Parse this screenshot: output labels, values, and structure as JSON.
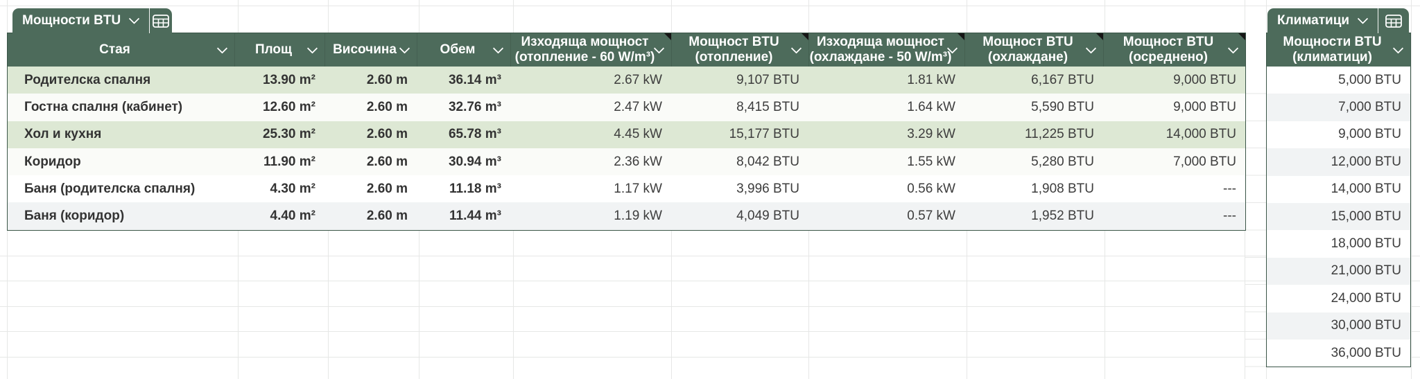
{
  "colors": {
    "accent_green": "#4d6b5b",
    "border_green": "#3a5547",
    "row_green": "#dde8d4",
    "row_gray": "#f1f3f4",
    "header_text": "#ffffff"
  },
  "icons": {
    "tab_icon": "table-grid-icon",
    "header_dropdown": "chevron-down-icon",
    "comment_marker": "comment-triangle"
  },
  "main_table": {
    "tab": {
      "title": "Мощности BTU"
    },
    "columns": [
      {
        "line1": "Стая"
      },
      {
        "line1": "Площ"
      },
      {
        "line1": "Височина"
      },
      {
        "line1": "Обем"
      },
      {
        "line1": "Изходяща мощност",
        "line2": "(отопление - 60 W/m³)"
      },
      {
        "line1": "Мощност BTU",
        "line2": "(отопление)"
      },
      {
        "line1": "Изходяща мощност",
        "line2": "(охлаждане - 50 W/m³)"
      },
      {
        "line1": "Мощност BTU",
        "line2": "(охлаждане)"
      },
      {
        "line1": "Мощност BTU",
        "line2": "(осреднено)"
      }
    ],
    "rows": [
      {
        "room": "Родителска спалня",
        "area": "13.90 m²",
        "height": "2.60 m",
        "volume": "36.14 m³",
        "heat_kw": "2.67 kW",
        "heat_btu": "9,107 BTU",
        "cool_kw": "1.81 kW",
        "cool_btu": "6,167 BTU",
        "avg_btu": "9,000 BTU"
      },
      {
        "room": "Гостна спалня (кабинет)",
        "area": "12.60 m²",
        "height": "2.60 m",
        "volume": "32.76 m³",
        "heat_kw": "2.47 kW",
        "heat_btu": "8,415 BTU",
        "cool_kw": "1.64 kW",
        "cool_btu": "5,590 BTU",
        "avg_btu": "9,000 BTU"
      },
      {
        "room": "Хол и кухня",
        "area": "25.30 m²",
        "height": "2.60 m",
        "volume": "65.78 m³",
        "heat_kw": "4.45 kW",
        "heat_btu": "15,177 BTU",
        "cool_kw": "3.29 kW",
        "cool_btu": "11,225 BTU",
        "avg_btu": "14,000 BTU"
      },
      {
        "room": "Коридор",
        "area": "11.90 m²",
        "height": "2.60 m",
        "volume": "30.94 m³",
        "heat_kw": "2.36 kW",
        "heat_btu": "8,042 BTU",
        "cool_kw": "1.55 kW",
        "cool_btu": "5,280 BTU",
        "avg_btu": "7,000 BTU"
      },
      {
        "room": "Баня (родителска спалня)",
        "area": "4.30 m²",
        "height": "2.60 m",
        "volume": "11.18 m³",
        "heat_kw": "1.17 kW",
        "heat_btu": "3,996 BTU",
        "cool_kw": "0.56 kW",
        "cool_btu": "1,908 BTU",
        "avg_btu": "---"
      },
      {
        "room": "Баня (коридор)",
        "area": "4.40 m²",
        "height": "2.60 m",
        "volume": "11.44 m³",
        "heat_kw": "1.19 kW",
        "heat_btu": "4,049 BTU",
        "cool_kw": "0.57 kW",
        "cool_btu": "1,952 BTU",
        "avg_btu": "---"
      }
    ]
  },
  "ac_table": {
    "tab": {
      "title": "Климатици"
    },
    "header": {
      "line1": "Мощности BTU",
      "line2": "(климатици)"
    },
    "rows": [
      "5,000 BTU",
      "7,000 BTU",
      "9,000 BTU",
      "12,000 BTU",
      "14,000 BTU",
      "15,000 BTU",
      "18,000 BTU",
      "21,000 BTU",
      "24,000 BTU",
      "30,000 BTU",
      "36,000 BTU"
    ]
  }
}
